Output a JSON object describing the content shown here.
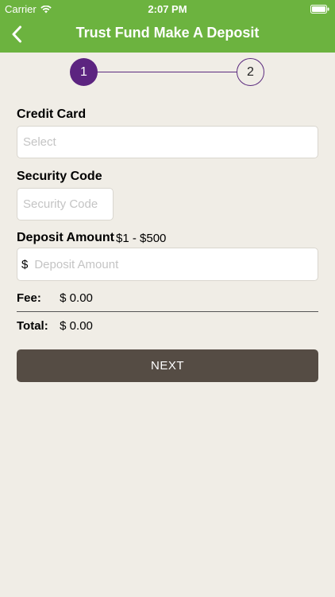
{
  "status_bar": {
    "carrier": "Carrier",
    "time": "2:07 PM"
  },
  "header": {
    "title": "Trust Fund Make A Deposit",
    "back_icon": "chevron-left-icon",
    "background_color": "#6cb33f"
  },
  "stepper": {
    "steps": [
      "1",
      "2"
    ],
    "active_step": 1,
    "active_color": "#5c2480"
  },
  "form": {
    "credit_card": {
      "label": "Credit Card",
      "placeholder": "Select"
    },
    "security_code": {
      "label": "Security Code",
      "placeholder": "Security Code"
    },
    "deposit_amount": {
      "label": "Deposit Amount",
      "range": "$1 - $500",
      "currency_symbol": "$",
      "placeholder": "Deposit Amount"
    }
  },
  "summary": {
    "fee_label": "Fee:",
    "fee_value": "$ 0.00",
    "total_label": "Total:",
    "total_value": "$ 0.00"
  },
  "actions": {
    "next_label": "NEXT",
    "next_color": "#554c44"
  }
}
